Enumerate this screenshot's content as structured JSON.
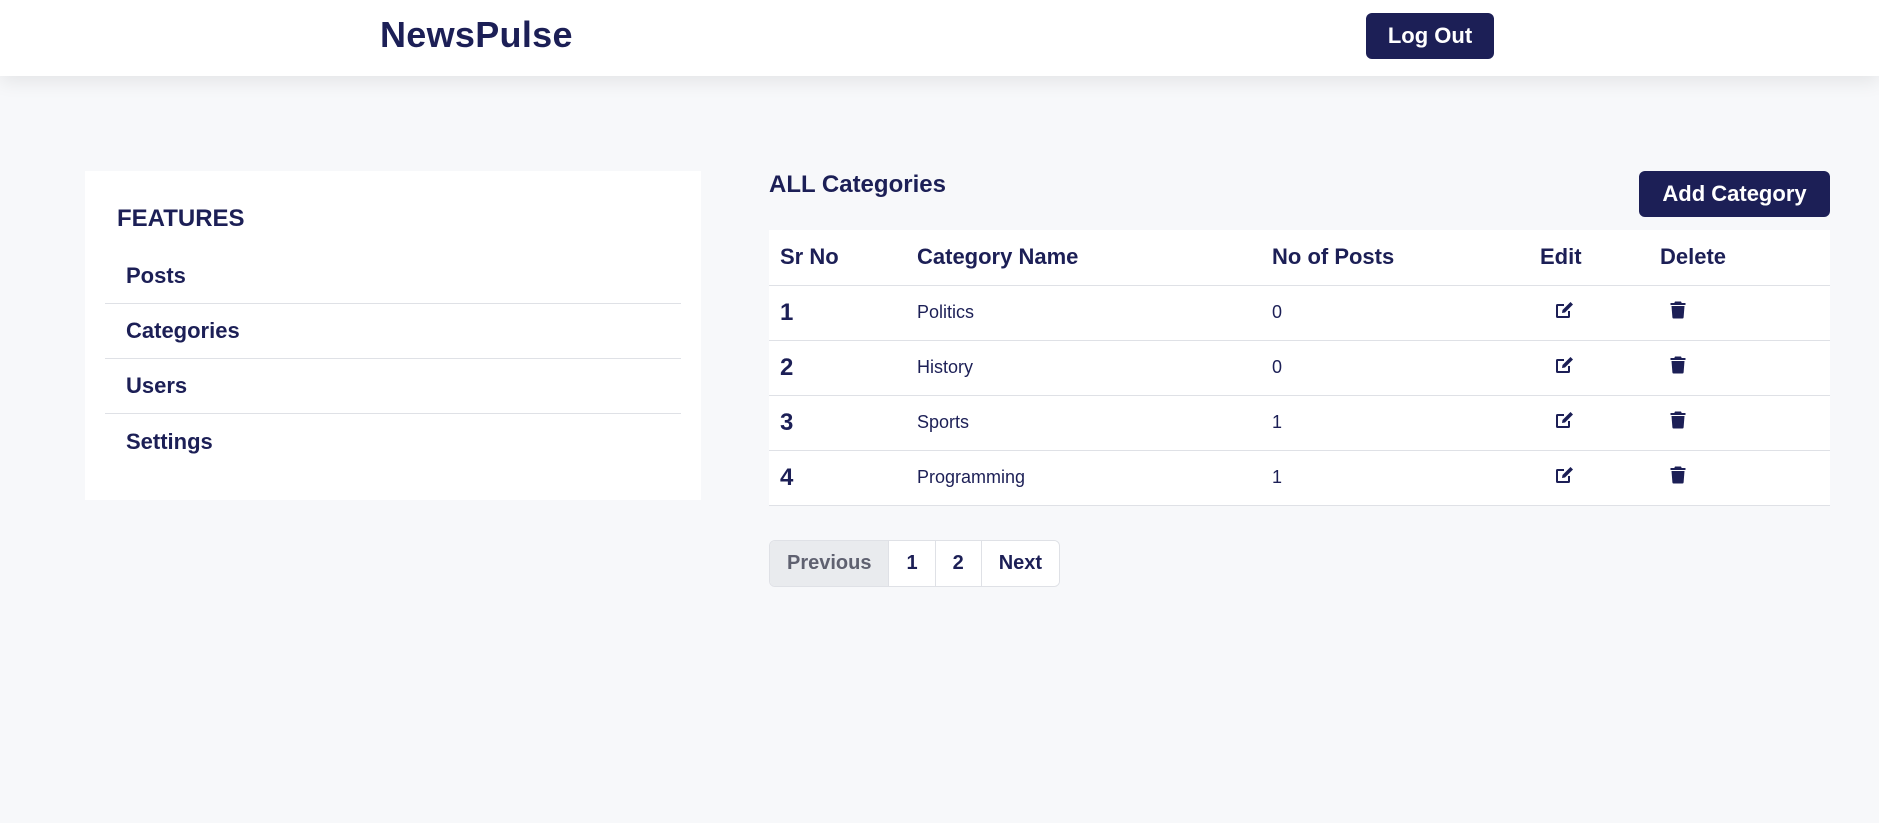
{
  "header": {
    "brand": "NewsPulse",
    "logout_label": "Log Out"
  },
  "sidebar": {
    "heading": "FEATURES",
    "items": [
      {
        "label": "Posts"
      },
      {
        "label": "Categories"
      },
      {
        "label": "Users"
      },
      {
        "label": "Settings"
      }
    ]
  },
  "main": {
    "title": "ALL Categories",
    "add_label": "Add Category",
    "table": {
      "columns": [
        "Sr No",
        "Category Name",
        "No of Posts",
        "Edit",
        "Delete"
      ],
      "rows": [
        {
          "sr": "1",
          "name": "Politics",
          "posts": "0"
        },
        {
          "sr": "2",
          "name": "History",
          "posts": "0"
        },
        {
          "sr": "3",
          "name": "Sports",
          "posts": "1"
        },
        {
          "sr": "4",
          "name": "Programming",
          "posts": "1"
        }
      ]
    },
    "pagination": {
      "previous": "Previous",
      "pages": [
        "1",
        "2"
      ],
      "next": "Next"
    }
  },
  "icons": {
    "edit": "edit-icon",
    "delete": "trash-icon"
  },
  "colors": {
    "primary": "#1c1f56",
    "background": "#f7f8fa",
    "border": "#dfe1e6"
  }
}
